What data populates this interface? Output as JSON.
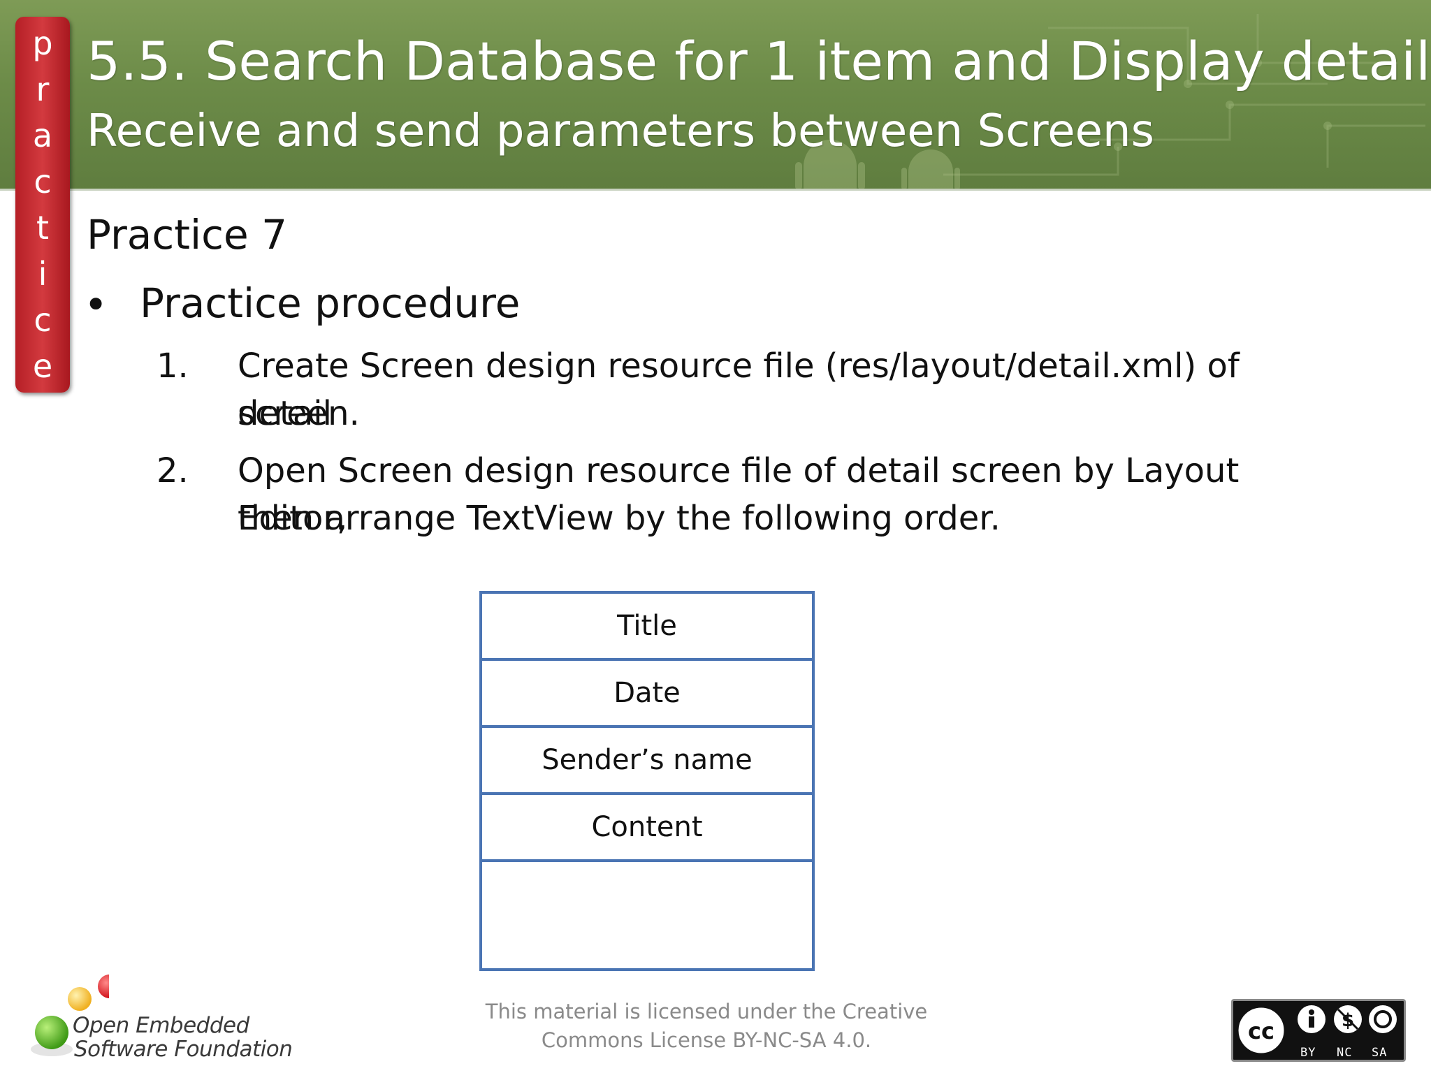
{
  "header": {
    "title": "5.5. Search Database for 1 item and Display detail",
    "subtitle": "Receive and send parameters between Screens"
  },
  "side_tab": {
    "letters": [
      "p",
      "r",
      "a",
      "c",
      "t",
      "i",
      "c",
      "e"
    ]
  },
  "content": {
    "section_title": "Practice 7",
    "bullet": "Practice procedure",
    "steps": [
      {
        "number": "1.",
        "line1": "Create Screen design resource file (res/layout/detail.xml) of detail",
        "line2": "screen."
      },
      {
        "number": "2.",
        "line1": "Open Screen design resource file of detail screen by Layout Editor,",
        "line2": "then arrange TextView by the following order."
      }
    ]
  },
  "diagram": {
    "rows": [
      "Title",
      "Date",
      "Sender’s name",
      "Content",
      ""
    ]
  },
  "footer": {
    "license_line1": "This material is licensed under the Creative",
    "license_line2": "Commons License BY-NC-SA 4.0.",
    "logo_line1": "Open Embedded",
    "logo_line2": "Software Foundation",
    "cc_labels": [
      "BY",
      "NC",
      "SA"
    ]
  },
  "colors": {
    "header_green": "#6c8b48",
    "tab_red": "#c8292f",
    "diagram_border": "#4a74b3",
    "license_gray": "#8a8a8a"
  }
}
